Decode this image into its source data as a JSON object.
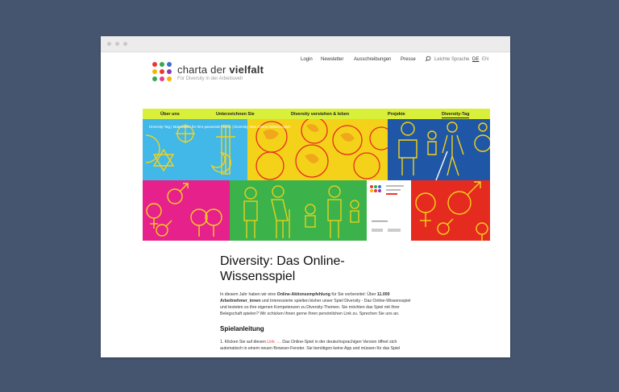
{
  "topnav": {
    "links": [
      "Login",
      "Newsletter",
      "Ausschreibungen",
      "Presse"
    ],
    "search_icon": "search-icon",
    "easy_language": "Leichte Sprache",
    "lang_de": "DE",
    "lang_en": "EN"
  },
  "logo": {
    "name_regular": "charta der ",
    "name_bold": "vielfalt",
    "tagline": "Für Diversity in der Arbeitswelt",
    "dot_colors": [
      "#e8392f",
      "#34a853",
      "#3b6fd6",
      "#f7b500",
      "#e8392f",
      "#8a3ab9",
      "#34a853",
      "#e83e8c",
      "#f7b500"
    ]
  },
  "mainnav": {
    "items": [
      "Über uns",
      "Unterzeichnen Sie",
      "Diversity verstehen & leben",
      "Projekte",
      "Diversity-Tag"
    ]
  },
  "breadcrumb": "Diversity-Tag  |  Materialien für Ihre passende Aktion  |  Diversity: Das Online-Wissensspiel",
  "article": {
    "title": "Diversity: Das Online-Wissensspiel",
    "intro_1": "In diesem Jahr haben wir eine ",
    "intro_bold_1": "Online-Aktionsempfehlung",
    "intro_2": " für Sie vorbereitet: Über ",
    "intro_bold_2": "11.000 Arbeitnehmer_innen",
    "intro_3": " und Interessierte spielten bisher unser Spiel Diversity - Das Online-Wissensspiel und testeten so ihre eigenen Kompetenzen zu Diversity-Themen. Sie möchten das Spiel mit Ihrer Belegschaft spielen? Wir schicken Ihnen gerne Ihren persönlichen Link zu. Sprechen Sie uns an.",
    "section_title": "Spielanleitung",
    "step_1a": "1. Klicken Sie auf diesen ",
    "step_link": "Link →",
    "step_1b": ". Das Online-Spiel in der deutschsprachigen Version öffnet sich automatisch in einem neuen Browser-Fenster. Sie benötigen keine App und müssen für das Spiel"
  },
  "colors": {
    "background": "#45556f",
    "nav_accent": "#d8f03a",
    "tile_blue": "#41b8e8",
    "tile_yellow": "#f5d21a",
    "tile_darkblue": "#1f56a5",
    "tile_magenta": "#e6218b",
    "tile_green": "#3bb34a",
    "tile_red": "#e52b1f",
    "link": "#d64545"
  }
}
